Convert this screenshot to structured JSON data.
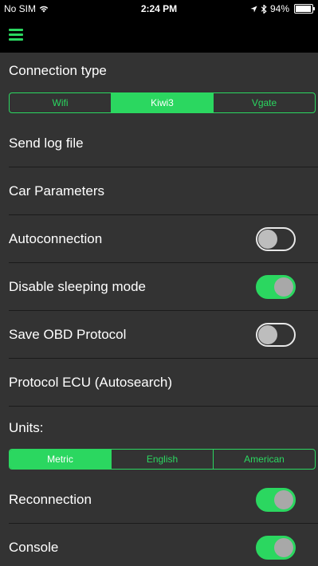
{
  "status_bar": {
    "carrier": "No SIM",
    "wifi_icon": "wifi-icon",
    "time": "2:24 PM",
    "location_icon": "location-arrow-icon",
    "bluetooth_icon": "bluetooth-icon",
    "battery_percent": "94%",
    "battery_level": 0.94
  },
  "nav": {
    "menu_icon": "hamburger-menu-icon"
  },
  "colors": {
    "accent": "#2bd760",
    "background": "#333333",
    "bar": "#000000"
  },
  "connection": {
    "title": "Connection type",
    "options": [
      "Wifi",
      "Kiwi3",
      "Vgate"
    ],
    "selected": "Kiwi3"
  },
  "items": {
    "send_log": "Send log file",
    "car_params": "Car Parameters",
    "autoconnection": {
      "label": "Autoconnection",
      "on": false
    },
    "disable_sleep": {
      "label": "Disable sleeping mode",
      "on": true
    },
    "save_obd": {
      "label": "Save OBD Protocol",
      "on": false
    },
    "protocol_ecu": "Protocol ECU (Autosearch)"
  },
  "units": {
    "title": "Units:",
    "options": [
      "Metric",
      "English",
      "American"
    ],
    "selected": "Metric"
  },
  "reconnection": {
    "label": "Reconnection",
    "on": true
  },
  "console": {
    "label": "Console",
    "on": true
  }
}
